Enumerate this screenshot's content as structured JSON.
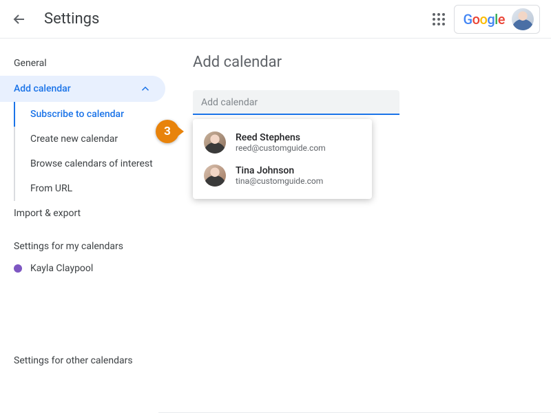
{
  "header": {
    "title": "Settings",
    "google_logo": "Google"
  },
  "sidebar": {
    "general": "General",
    "add_calendar": "Add calendar",
    "sub": {
      "subscribe": "Subscribe to calendar",
      "create": "Create new calendar",
      "browse": "Browse calendars of interest",
      "from_url": "From URL"
    },
    "import_export": "Import & export",
    "section_my": "Settings for my calendars",
    "my_cal_1": "Kayla Claypool",
    "section_other": "Settings for other calendars"
  },
  "main": {
    "heading": "Add calendar",
    "input_placeholder": "Add calendar"
  },
  "dropdown": {
    "items": [
      {
        "name": "Reed Stephens",
        "email": "reed@customguide.com"
      },
      {
        "name": "Tina Johnson",
        "email": "tina@customguide.com"
      }
    ]
  },
  "step_badge": "3",
  "colors": {
    "accent": "#1a73e8",
    "badge": "#e8830b",
    "cal_dot": "#7e57c2"
  }
}
